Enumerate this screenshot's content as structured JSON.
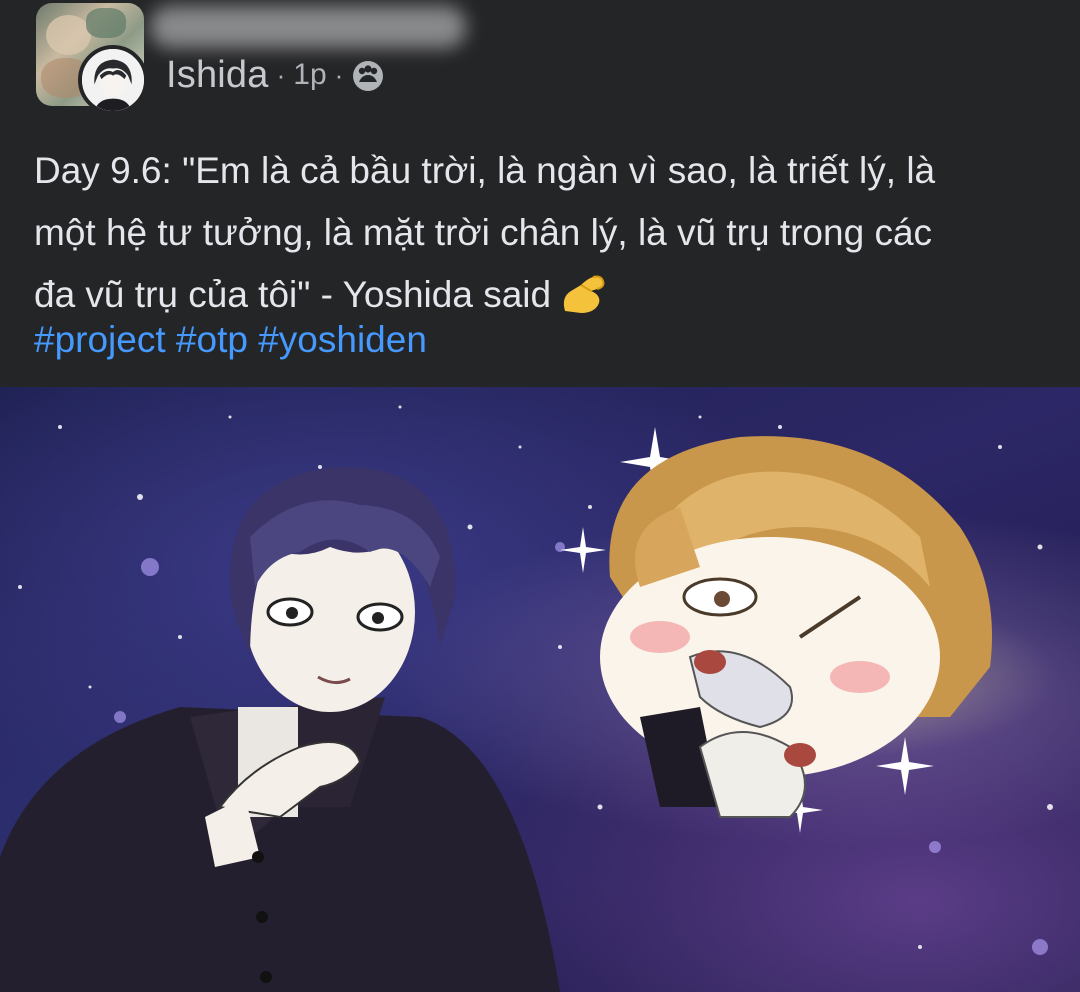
{
  "post": {
    "author_name": "Ishida",
    "separator": "·",
    "time": "1p",
    "audience_icon": "group-icon",
    "text_lines": [
      "Day 9.6: \"Em là cả bầu trời, là ngàn vì sao, là triết lý, là",
      "một hệ tư tưởng, là mặt trời chân lý, là vũ trụ trong các",
      "đa vũ trụ của tôi\" - Yoshida said"
    ],
    "emoji": "pinched-fingers-emoji",
    "hashtags": [
      "#project",
      "#otp",
      "#yoshiden"
    ]
  },
  "colors": {
    "background": "#242526",
    "text": "#e4e6eb",
    "meta": "#b0b3b8",
    "hashtag": "#4599ff"
  }
}
